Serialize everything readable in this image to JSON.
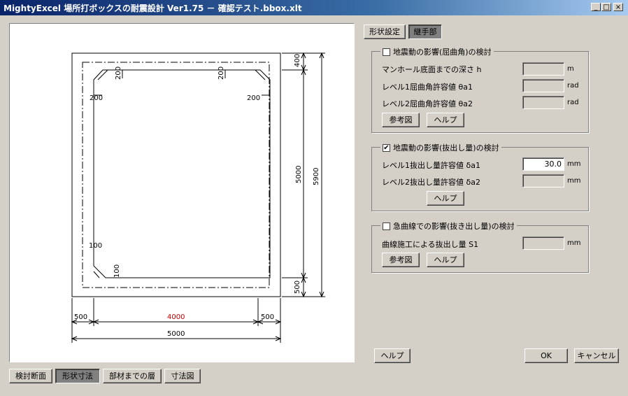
{
  "window": {
    "title": "MightyExcel 場所打ボックスの耐震設計 Ver1.75  －  確認テスト.bbox.xlt"
  },
  "window_controls": {
    "minimize": "_",
    "maximize": "□",
    "close": "×"
  },
  "top_tabs": [
    "形状設定",
    "継手部"
  ],
  "bottom_tabs": [
    "検討断面",
    "形状寸法",
    "部材までの層",
    "寸法図"
  ],
  "drawing": {
    "dims": {
      "top_cover": "400",
      "inner_height": "5000",
      "total_height": "5900",
      "bottom_cover": "500",
      "left_cover": "500",
      "inner_width": "4000",
      "right_cover": "500",
      "total_width": "5000"
    },
    "haunches": {
      "top_left": "200",
      "top_right": "200",
      "left_top": "200",
      "right_top": "200",
      "bottom_left_v": "100",
      "bottom_left_h": "100"
    },
    "colors": {
      "outline": "#000000",
      "highlight_dim": "#c00000"
    }
  },
  "group1": {
    "title": "地震動の影響(屈曲角)の検討",
    "checked": false,
    "rows": [
      {
        "label": "マンホール底面までの深さ  h",
        "value": "",
        "unit": "m"
      },
      {
        "label": "レベル1屈曲角許容値  θa1",
        "value": "",
        "unit": "rad"
      },
      {
        "label": "レベル2屈曲角許容値  θa2",
        "value": "",
        "unit": "rad"
      }
    ],
    "ref_button": "参考図",
    "help_button": "ヘルプ"
  },
  "group2": {
    "title": "地震動の影響(抜出し量)の検討",
    "checked": true,
    "rows": [
      {
        "label": "レベル1抜出し量許容値 δa1",
        "value": "30.0",
        "unit": "mm"
      },
      {
        "label": "レベル2抜出し量許容値 δa2",
        "value": "",
        "unit": "mm"
      }
    ],
    "help_button": "ヘルプ"
  },
  "group3": {
    "title": "急曲線での影響(抜き出し量)の検討",
    "checked": false,
    "rows": [
      {
        "label": "曲線施工による抜出し量  S1",
        "value": "",
        "unit": "mm"
      }
    ],
    "ref_button": "参考図",
    "help_button": "ヘルプ"
  },
  "footer": {
    "help": "ヘルプ",
    "ok": "OK",
    "cancel": "キャンセル"
  }
}
